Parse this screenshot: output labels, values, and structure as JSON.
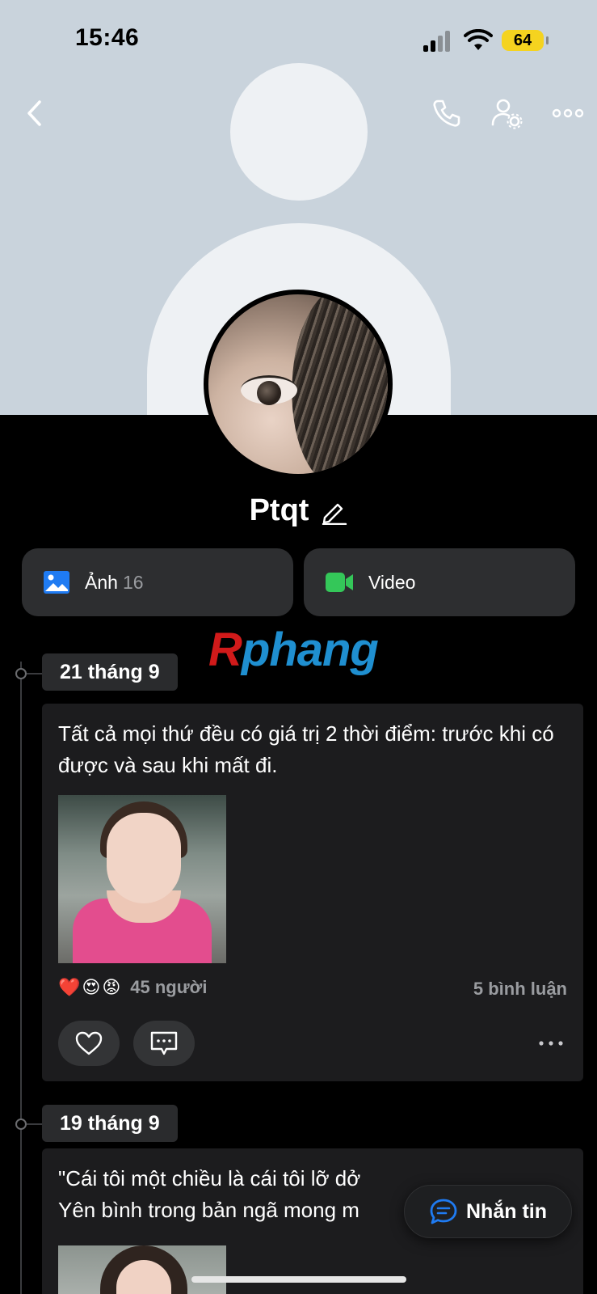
{
  "status_bar": {
    "time": "15:46",
    "battery": "64"
  },
  "profile": {
    "name": "Ptqt"
  },
  "media": {
    "photos_label": "Ảnh",
    "photos_count": "16",
    "video_label": "Video"
  },
  "watermark": {
    "first": "R",
    "rest": "phang"
  },
  "posts": [
    {
      "date": "21 tháng 9",
      "text": "Tất cả mọi thứ đều có giá trị 2 thời điểm: trước khi có được và sau khi mất đi.",
      "reactions": [
        "❤️",
        "😍",
        "😡"
      ],
      "reactions_count": "45 người",
      "comments_count": "5 bình luận"
    },
    {
      "date": "19 tháng 9",
      "text_line1": "\"Cái tôi một chiều là cái tôi lỡ dở",
      "text_line2": "Yên bình trong bản ngã mong m"
    }
  ],
  "message_button": {
    "label": "Nhắn tin"
  },
  "colors": {
    "accent_blue": "#1f7bf2",
    "video_green": "#34c759",
    "battery_yellow": "#f5d31f"
  }
}
